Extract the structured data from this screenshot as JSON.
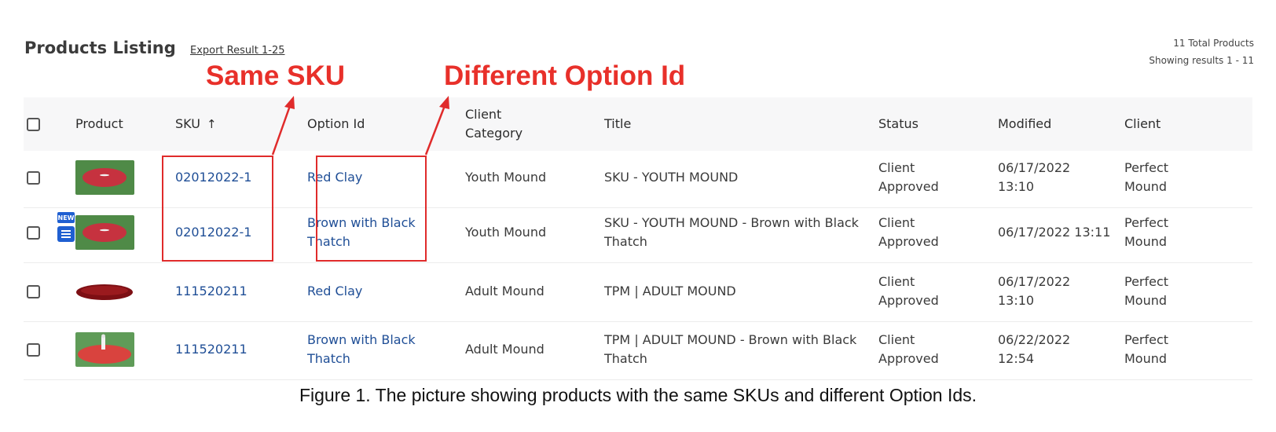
{
  "header": {
    "title": "Products Listing",
    "export_link": "Export Result 1-25",
    "total_products": "11 Total Products",
    "showing": "Showing results 1 - 11"
  },
  "annotations": {
    "same_sku": "Same SKU",
    "different_option": "Different Option Id",
    "color": "#e8302a"
  },
  "columns": {
    "product": "Product",
    "sku": "SKU",
    "sku_sort_icon": "arrow-up-icon",
    "option_id": "Option Id",
    "client_category_line1": "Client",
    "client_category_line2": "Category",
    "title": "Title",
    "status": "Status",
    "modified": "Modified",
    "client": "Client"
  },
  "rows": [
    {
      "sku": "02012022-1",
      "option_line1": "Red Clay",
      "option_line2": "",
      "category": "Youth Mound",
      "title_line1": "SKU - YOUTH MOUND",
      "title_line2": "",
      "status_line1": "Client",
      "status_line2": "Approved",
      "modified_line1": "06/17/2022",
      "modified_line2": "13:10",
      "client_line1": "Perfect",
      "client_line2": "Mound",
      "image": "youth-mound-thumbnail",
      "new": false
    },
    {
      "sku": "02012022-1",
      "option_line1": "Brown with Black",
      "option_line2": "Thatch",
      "category": "Youth Mound",
      "title_line1": "SKU - YOUTH MOUND - Brown with Black",
      "title_line2": "Thatch",
      "status_line1": "Client",
      "status_line2": "Approved",
      "modified_line1": "06/17/2022 13:11",
      "modified_line2": "",
      "client_line1": "Perfect",
      "client_line2": "Mound",
      "image": "youth-mound-thumbnail",
      "new": true,
      "new_label": "NEW"
    },
    {
      "sku": "111520211",
      "option_line1": "Red Clay",
      "option_line2": "",
      "category": "Adult Mound",
      "title_line1": "TPM | ADULT MOUND",
      "title_line2": "",
      "status_line1": "Client",
      "status_line2": "Approved",
      "modified_line1": "06/17/2022",
      "modified_line2": "13:10",
      "client_line1": "Perfect",
      "client_line2": "Mound",
      "image": "adult-mound-thumbnail",
      "new": false
    },
    {
      "sku": "111520211",
      "option_line1": "Brown with Black",
      "option_line2": "Thatch",
      "category": "Adult Mound",
      "title_line1": "TPM | ADULT MOUND - Brown with Black",
      "title_line2": "Thatch",
      "status_line1": "Client",
      "status_line2": "Approved",
      "modified_line1": "06/22/2022",
      "modified_line2": "12:54",
      "client_line1": "Perfect",
      "client_line2": "Mound",
      "image": "pitcher-mound-thumbnail",
      "new": false
    }
  ],
  "caption": "Figure 1. The picture showing products with the same SKUs and different Option Ids.",
  "colors": {
    "link": "#1f4e96",
    "badge": "#1f5fd1",
    "header_bg": "#f7f7f8"
  }
}
